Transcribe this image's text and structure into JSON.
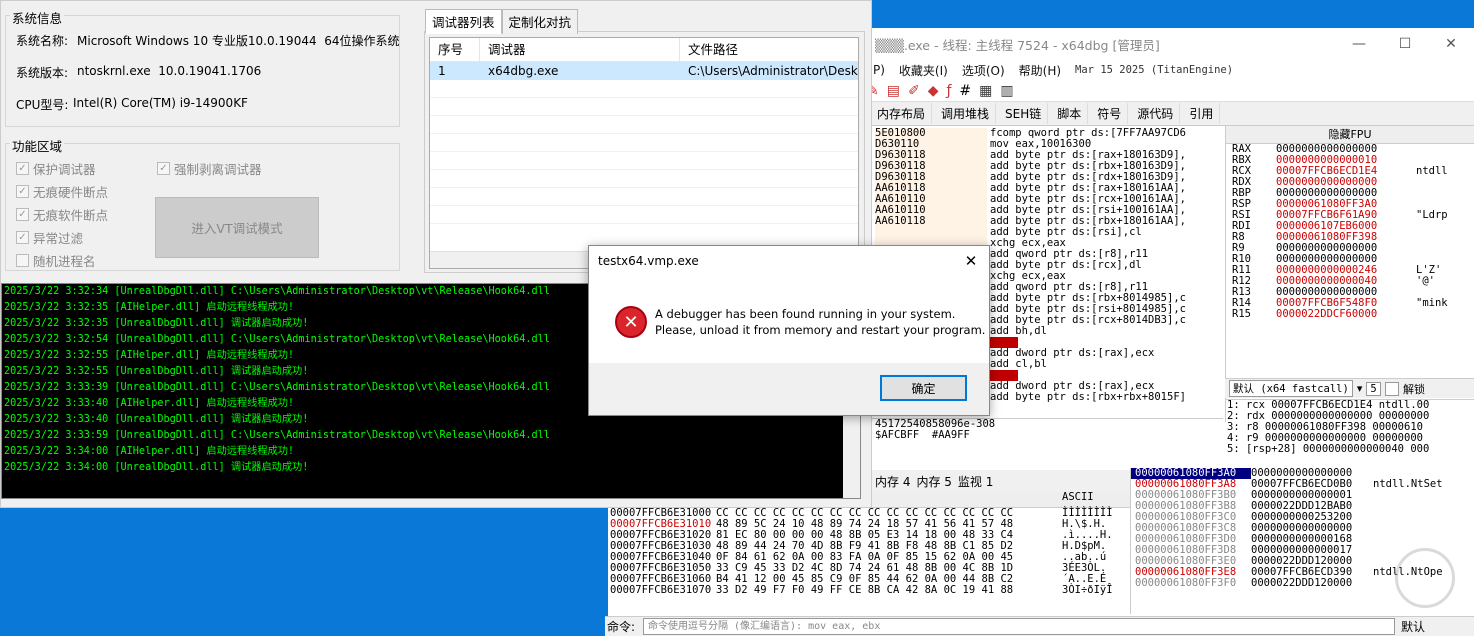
{
  "dbg": {
    "title": "▒▒▒.exe - 线程: 主线程 7524 - x64dbg [管理员]",
    "ctrls": [
      "—",
      "☐",
      "✕"
    ],
    "menu": [
      "P)",
      "收藏夹(I)",
      "选项(O)",
      "帮助(H)"
    ],
    "menu_date": "Mar 15 2025 (TitanEngine)",
    "tabs": [
      "内存布局",
      "调用堆栈",
      "SEH链",
      "脚本",
      "符号",
      "源代码",
      "引用"
    ],
    "disasm_addrs": [
      "5E010800",
      "D630110",
      "D9630118",
      "D9630118",
      "D9630118",
      "AA610118",
      "AA610110",
      "AA610110",
      "AA610118"
    ],
    "disasm_ins": [
      "fcomp qword ptr ds:[7FF7AA97CD6",
      "mov eax,10016300",
      "add byte ptr ds:[rax+180163D9],",
      "add byte ptr ds:[rbx+180163D9],",
      "add byte ptr ds:[rdx+180163D9],",
      "add byte ptr ds:[rax+180161AA],",
      "add byte ptr ds:[rcx+100161AA],",
      "add byte ptr ds:[rsi+100161AA],",
      "add byte ptr ds:[rbx+180161AA],",
      "add byte ptr ds:[rsi],cl",
      "xchg ecx,eax",
      "add qword ptr ds:[r8],r11",
      "add byte ptr ds:[rcx],dl",
      "xchg ecx,eax",
      "add qword ptr ds:[r8],r11",
      "add byte ptr ds:[rbx+8014985],c",
      "add byte ptr ds:[rsi+8014985],c",
      "add byte ptr ds:[rcx+8014DB3],c",
      "add bh,dl",
      "",
      "add dword ptr ds:[rax],ecx",
      "add cl,bl",
      "",
      "add dword ptr ds:[rax],ecx",
      "add byte ptr ds:[rbx+rbx+8015F]"
    ],
    "info_lines": [
      "45172540858096e-308",
      "",
      "",
      "$AFCBFF  #AA9FF"
    ],
    "regs_header": "隐藏FPU",
    "regs": [
      {
        "n": "RAX",
        "v": "0000000000000000",
        "c": "",
        "ch": false
      },
      {
        "n": "RBX",
        "v": "0000000000000010",
        "c": "",
        "ch": true
      },
      {
        "n": "RCX",
        "v": "00007FFCB6ECD1E4",
        "c": "ntdll",
        "ch": true
      },
      {
        "n": "RDX",
        "v": "0000000000000000",
        "c": "",
        "ch": true
      },
      {
        "n": "RBP",
        "v": "0000000000000000",
        "c": "",
        "ch": false
      },
      {
        "n": "RSP",
        "v": "00000061080FF3A0",
        "c": "",
        "ch": true
      },
      {
        "n": "RSI",
        "v": "00007FFCB6F61A90",
        "c": "\"Ldrp",
        "ch": true
      },
      {
        "n": "RDI",
        "v": "00000061​07EB6000",
        "c": "",
        "ch": true
      },
      {
        "n": "",
        "v": "",
        "c": "",
        "ch": false
      },
      {
        "n": "R8",
        "v": "00000061080FF398",
        "c": "",
        "ch": true
      },
      {
        "n": "R9",
        "v": "0000000000000000",
        "c": "",
        "ch": false
      },
      {
        "n": "R10",
        "v": "0000000000000000",
        "c": "",
        "ch": false
      },
      {
        "n": "R11",
        "v": "0000000000000246",
        "c": "L'Z'",
        "ch": true
      },
      {
        "n": "R12",
        "v": "0000000000000040",
        "c": "'@'",
        "ch": true
      },
      {
        "n": "R13",
        "v": "0000000000000000",
        "c": "",
        "ch": false
      },
      {
        "n": "R14",
        "v": "00007FFCB6F548F0",
        "c": "\"mink",
        "ch": true
      },
      {
        "n": "R15",
        "v": "0000022DDCF60000",
        "c": "",
        "ch": true
      }
    ],
    "callconv": "默认 (x64 fastcall)",
    "argcount": "5",
    "unlock": "解锁",
    "args": [
      "1: rcx 00007FFCB6ECD1E4 ntdll.00",
      "2: rdx 0000000000000000 00000000",
      "3: r8 00000061080FF398 00000610",
      "4: r9 0000000000000000 00000000",
      "5: [rsp+28] 0000000000000040 000"
    ],
    "dump_tabs": [
      "内存 4",
      "内存 5",
      "监视 1"
    ],
    "stack": [
      {
        "a": "00000061080FF3A0",
        "v": "0000000000000000",
        "c": "",
        "t": "sel"
      },
      {
        "a": "00000061080FF3A8",
        "v": "00007FFCB6ECD0B0",
        "c": "ntdll.NtSet",
        "t": "red"
      },
      {
        "a": "00000061080FF3B0",
        "v": "0000000000000001",
        "c": "",
        "t": ""
      },
      {
        "a": "00000061080FF3B8",
        "v": "0000022DDD12BAB0",
        "c": "",
        "t": ""
      },
      {
        "a": "00000061080FF3C0",
        "v": "0000000000253200",
        "c": "",
        "t": ""
      },
      {
        "a": "00000061080FF3C8",
        "v": "0000000000000000",
        "c": "",
        "t": ""
      },
      {
        "a": "00000061080FF3D0",
        "v": "0000000000000168",
        "c": "",
        "t": ""
      },
      {
        "a": "00000061080FF3D8",
        "v": "0000000000000017",
        "c": "",
        "t": ""
      },
      {
        "a": "00000061080FF3E0",
        "v": "0000022DDD120000",
        "c": "",
        "t": ""
      },
      {
        "a": "00000061080FF3E8",
        "v": "00007FFCB6ECD390",
        "c": "ntdll.NtOpe",
        "t": "red"
      },
      {
        "a": "00000061080FF3F0",
        "v": "0000022DDD120000",
        "c": "",
        "t": ""
      }
    ],
    "dump_ascii_header": "ASCII",
    "dump": [
      {
        "a": "00007FFCB6E31000",
        "h": "CC CC CC CC CC CC CC CC CC CC CC CC CC CC CC CC",
        "t": "ÌÌÌÌÌÌÌÌ",
        "red": false
      },
      {
        "a": "00007FFCB6E31010",
        "h": "48 89 5C 24 10 48 89 74 24 18 57 41 56 41 57 48",
        "t": "H.\\$.H.",
        "red": true
      },
      {
        "a": "00007FFCB6E31020",
        "h": "81 EC 80 00 00 00 48 8B 05 E3 14 18 00 48 33 C4",
        "t": ".ì....H.",
        "red": false
      },
      {
        "a": "00007FFCB6E31030",
        "h": "48 89 44 24 70 4D 8B F9 41 8B F8 48 8B C1 85 D2",
        "t": "H.D$pM.",
        "red": false
      },
      {
        "a": "00007FFCB6E31040",
        "h": "0F 84 61 62 0A 00 83 FA 0A 0F 85 15 62 0A 00 45",
        "t": "..ab..ú",
        "red": false
      },
      {
        "a": "00007FFCB6E31050",
        "h": "33 C9 45 33 D2 4C 8D 74 24 61 48 8B 00 4C 8B 1D",
        "t": "3ÉE3ÒL.",
        "red": false
      },
      {
        "a": "00007FFCB6E31060",
        "h": "B4 41 12 00 45 85 C9 0F 85 44 62 0A 00 44 8B C2",
        "t": "´A..E.É",
        "red": false
      },
      {
        "a": "00007FFCB6E31070",
        "h": "33 D2 49 F7 F0 49 FF CE 8B CA 42 8A 0C 19 41 88",
        "t": "3ÒI÷ðIÿÎ",
        "red": false
      }
    ],
    "cmd_label": "命令:",
    "cmd_placeholder": "命令使用逗号分隔 (像汇编语言): mov eax, ebx",
    "cmd_default": "默认"
  },
  "tool": {
    "sysinfo_title": "系统信息",
    "os_label": "系统名称:",
    "os_value": "Microsoft Windows 10 专业版10.0.19044  64位操作系统",
    "ver_label": "系统版本:",
    "ver_value": "ntoskrnl.exe  10.0.19041.1706",
    "cpu_label": "CPU型号:",
    "cpu_value": "Intel(R) Core(TM) i9-14900KF",
    "func_title": "功能区域",
    "options": [
      {
        "label": "保护调试器",
        "checked": true
      },
      {
        "label": "无痕硬件断点",
        "checked": true
      },
      {
        "label": "无痕软件断点",
        "checked": true
      },
      {
        "label": "异常过滤",
        "checked": true
      },
      {
        "label": "随机进程名",
        "checked": false
      }
    ],
    "force_strip": "强制剥离调试器",
    "vt_button": "进入VT调试模式",
    "tabs": [
      "调试器列表",
      "定制化对抗"
    ],
    "list_headers": [
      "序号",
      "调试器",
      "文件路径"
    ],
    "list_rows": [
      {
        "idx": "1",
        "name": "x64dbg.exe",
        "path": "C:\\Users\\Administrator\\Desktop"
      }
    ],
    "log": [
      "2025/3/22 3:32:34 [UnrealDbgDll.dll] C:\\Users\\Administrator\\Desktop\\vt\\Release\\Hook64.dll",
      "2025/3/22 3:32:35 [AIHelper.dll] 启动远程线程成功!",
      "2025/3/22 3:32:35 [UnrealDbgDll.dll] 调试器启动成功!",
      "2025/3/22 3:32:54 [UnrealDbgDll.dll] C:\\Users\\Administrator\\Desktop\\vt\\Release\\Hook64.dll",
      "2025/3/22 3:32:55 [AIHelper.dll] 启动远程线程成功!",
      "2025/3/22 3:32:55 [UnrealDbgDll.dll] 调试器启动成功!",
      "2025/3/22 3:33:39 [UnrealDbgDll.dll] C:\\Users\\Administrator\\Desktop\\vt\\Release\\Hook64.dll",
      "2025/3/22 3:33:40 [AIHelper.dll] 启动远程线程成功!",
      "2025/3/22 3:33:40 [UnrealDbgDll.dll] 调试器启动成功!",
      "2025/3/22 3:33:59 [UnrealDbgDll.dll] C:\\Users\\Administrator\\Desktop\\vt\\Release\\Hook64.dll",
      "2025/3/22 3:34:00 [AIHelper.dll] 启动远程线程成功!",
      "2025/3/22 3:34:00 [UnrealDbgDll.dll] 调试器启动成功!"
    ]
  },
  "dialog": {
    "title": "testx64.vmp.exe",
    "close": "✕",
    "icon": "✕",
    "line1": "A debugger has been found running in your system.",
    "line2": "Please, unload it from memory and restart your program.",
    "ok": "确定"
  }
}
